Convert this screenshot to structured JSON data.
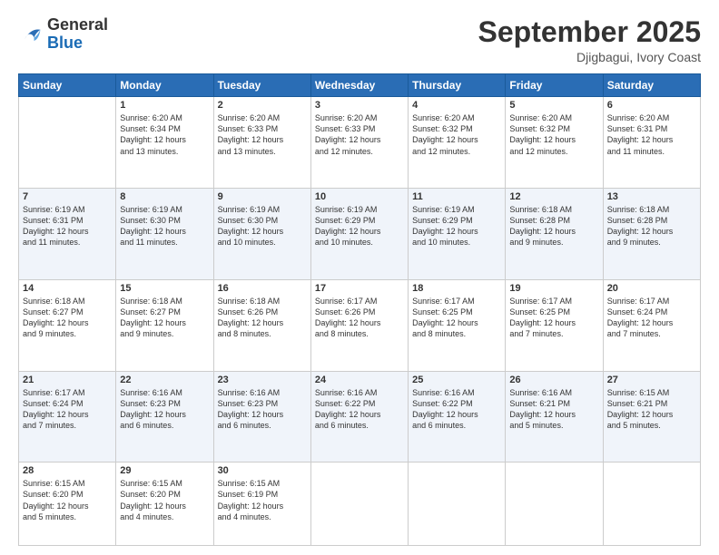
{
  "header": {
    "logo_general": "General",
    "logo_blue": "Blue",
    "month_title": "September 2025",
    "location": "Djigbagui, Ivory Coast"
  },
  "weekdays": [
    "Sunday",
    "Monday",
    "Tuesday",
    "Wednesday",
    "Thursday",
    "Friday",
    "Saturday"
  ],
  "weeks": [
    [
      {
        "num": "",
        "info": ""
      },
      {
        "num": "1",
        "info": "Sunrise: 6:20 AM\nSunset: 6:34 PM\nDaylight: 12 hours\nand 13 minutes."
      },
      {
        "num": "2",
        "info": "Sunrise: 6:20 AM\nSunset: 6:33 PM\nDaylight: 12 hours\nand 13 minutes."
      },
      {
        "num": "3",
        "info": "Sunrise: 6:20 AM\nSunset: 6:33 PM\nDaylight: 12 hours\nand 12 minutes."
      },
      {
        "num": "4",
        "info": "Sunrise: 6:20 AM\nSunset: 6:32 PM\nDaylight: 12 hours\nand 12 minutes."
      },
      {
        "num": "5",
        "info": "Sunrise: 6:20 AM\nSunset: 6:32 PM\nDaylight: 12 hours\nand 12 minutes."
      },
      {
        "num": "6",
        "info": "Sunrise: 6:20 AM\nSunset: 6:31 PM\nDaylight: 12 hours\nand 11 minutes."
      }
    ],
    [
      {
        "num": "7",
        "info": "Sunrise: 6:19 AM\nSunset: 6:31 PM\nDaylight: 12 hours\nand 11 minutes."
      },
      {
        "num": "8",
        "info": "Sunrise: 6:19 AM\nSunset: 6:30 PM\nDaylight: 12 hours\nand 11 minutes."
      },
      {
        "num": "9",
        "info": "Sunrise: 6:19 AM\nSunset: 6:30 PM\nDaylight: 12 hours\nand 10 minutes."
      },
      {
        "num": "10",
        "info": "Sunrise: 6:19 AM\nSunset: 6:29 PM\nDaylight: 12 hours\nand 10 minutes."
      },
      {
        "num": "11",
        "info": "Sunrise: 6:19 AM\nSunset: 6:29 PM\nDaylight: 12 hours\nand 10 minutes."
      },
      {
        "num": "12",
        "info": "Sunrise: 6:18 AM\nSunset: 6:28 PM\nDaylight: 12 hours\nand 9 minutes."
      },
      {
        "num": "13",
        "info": "Sunrise: 6:18 AM\nSunset: 6:28 PM\nDaylight: 12 hours\nand 9 minutes."
      }
    ],
    [
      {
        "num": "14",
        "info": "Sunrise: 6:18 AM\nSunset: 6:27 PM\nDaylight: 12 hours\nand 9 minutes."
      },
      {
        "num": "15",
        "info": "Sunrise: 6:18 AM\nSunset: 6:27 PM\nDaylight: 12 hours\nand 9 minutes."
      },
      {
        "num": "16",
        "info": "Sunrise: 6:18 AM\nSunset: 6:26 PM\nDaylight: 12 hours\nand 8 minutes."
      },
      {
        "num": "17",
        "info": "Sunrise: 6:17 AM\nSunset: 6:26 PM\nDaylight: 12 hours\nand 8 minutes."
      },
      {
        "num": "18",
        "info": "Sunrise: 6:17 AM\nSunset: 6:25 PM\nDaylight: 12 hours\nand 8 minutes."
      },
      {
        "num": "19",
        "info": "Sunrise: 6:17 AM\nSunset: 6:25 PM\nDaylight: 12 hours\nand 7 minutes."
      },
      {
        "num": "20",
        "info": "Sunrise: 6:17 AM\nSunset: 6:24 PM\nDaylight: 12 hours\nand 7 minutes."
      }
    ],
    [
      {
        "num": "21",
        "info": "Sunrise: 6:17 AM\nSunset: 6:24 PM\nDaylight: 12 hours\nand 7 minutes."
      },
      {
        "num": "22",
        "info": "Sunrise: 6:16 AM\nSunset: 6:23 PM\nDaylight: 12 hours\nand 6 minutes."
      },
      {
        "num": "23",
        "info": "Sunrise: 6:16 AM\nSunset: 6:23 PM\nDaylight: 12 hours\nand 6 minutes."
      },
      {
        "num": "24",
        "info": "Sunrise: 6:16 AM\nSunset: 6:22 PM\nDaylight: 12 hours\nand 6 minutes."
      },
      {
        "num": "25",
        "info": "Sunrise: 6:16 AM\nSunset: 6:22 PM\nDaylight: 12 hours\nand 6 minutes."
      },
      {
        "num": "26",
        "info": "Sunrise: 6:16 AM\nSunset: 6:21 PM\nDaylight: 12 hours\nand 5 minutes."
      },
      {
        "num": "27",
        "info": "Sunrise: 6:15 AM\nSunset: 6:21 PM\nDaylight: 12 hours\nand 5 minutes."
      }
    ],
    [
      {
        "num": "28",
        "info": "Sunrise: 6:15 AM\nSunset: 6:20 PM\nDaylight: 12 hours\nand 5 minutes."
      },
      {
        "num": "29",
        "info": "Sunrise: 6:15 AM\nSunset: 6:20 PM\nDaylight: 12 hours\nand 4 minutes."
      },
      {
        "num": "30",
        "info": "Sunrise: 6:15 AM\nSunset: 6:19 PM\nDaylight: 12 hours\nand 4 minutes."
      },
      {
        "num": "",
        "info": ""
      },
      {
        "num": "",
        "info": ""
      },
      {
        "num": "",
        "info": ""
      },
      {
        "num": "",
        "info": ""
      }
    ]
  ]
}
